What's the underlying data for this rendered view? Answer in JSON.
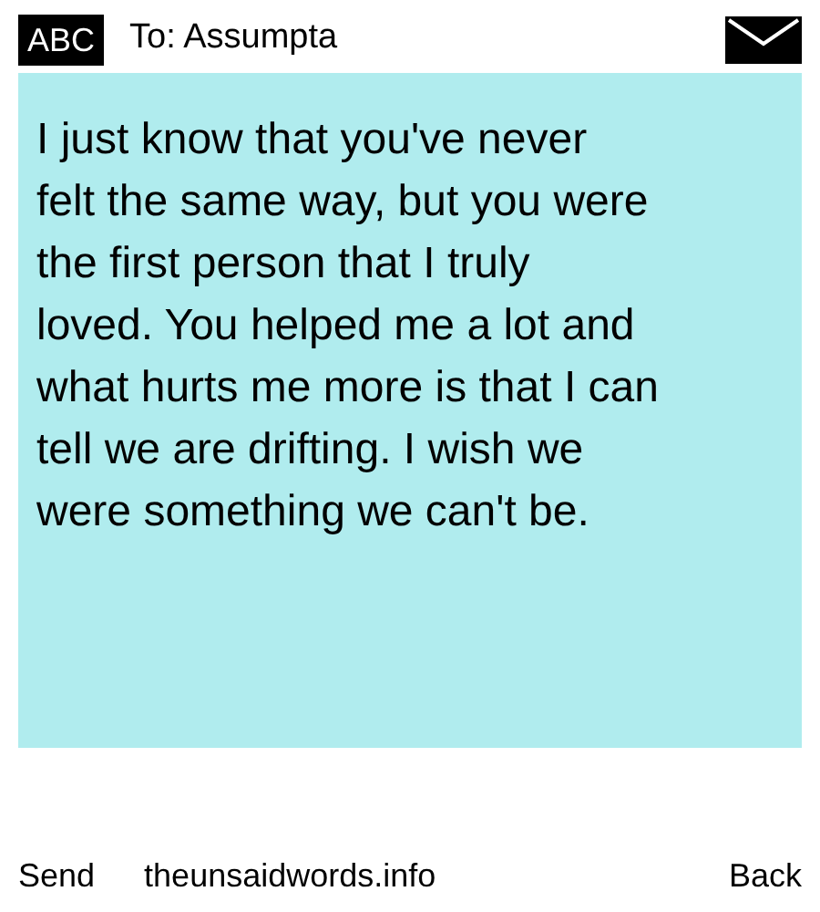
{
  "header": {
    "badge": "ABC",
    "recipient": "To: Assumpta"
  },
  "message": {
    "lines": [
      "I just know that you've never",
      "felt the same way, but you were",
      "the first person that I truly",
      "loved. You helped me a lot and",
      "what hurts me more is that I can",
      "tell we are drifting. I wish we",
      "were something we can't be."
    ]
  },
  "footer": {
    "send": "Send",
    "site": "theunsaidwords.info",
    "back": "Back"
  }
}
